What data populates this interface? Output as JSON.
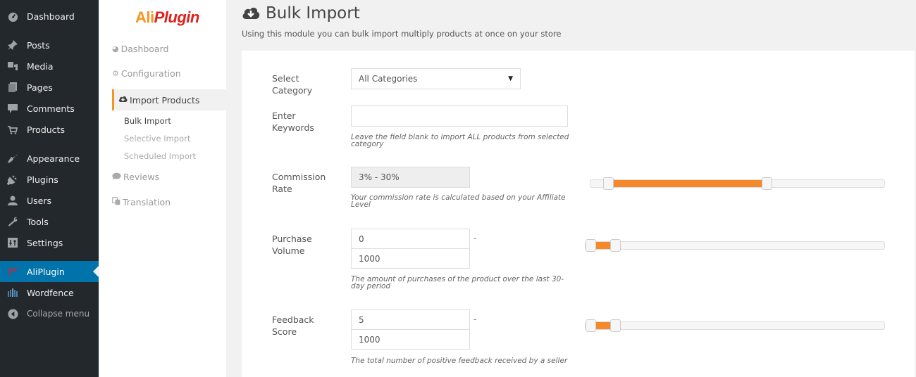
{
  "wp_sidebar": {
    "items": [
      {
        "label": "Dashboard",
        "icon": "dashboard-icon"
      },
      {
        "label": "Posts",
        "icon": "pin-icon"
      },
      {
        "label": "Media",
        "icon": "media-icon"
      },
      {
        "label": "Pages",
        "icon": "pages-icon"
      },
      {
        "label": "Comments",
        "icon": "comment-icon"
      },
      {
        "label": "Products",
        "icon": "cart-icon"
      },
      {
        "label": "Appearance",
        "icon": "brush-icon"
      },
      {
        "label": "Plugins",
        "icon": "plug-icon"
      },
      {
        "label": "Users",
        "icon": "user-icon"
      },
      {
        "label": "Tools",
        "icon": "wrench-icon"
      },
      {
        "label": "Settings",
        "icon": "settings-icon"
      },
      {
        "label": "AliPlugin",
        "icon": "aliplugin-icon",
        "active": true
      },
      {
        "label": "Wordfence",
        "icon": "wordfence-icon"
      },
      {
        "label": "Collapse menu",
        "icon": "collapse-icon"
      }
    ]
  },
  "plugin_nav": {
    "logo": {
      "part1": "Ali",
      "part2": "Plugin"
    },
    "items": [
      {
        "label": "Dashboard",
        "icon": "dashboard-icon"
      },
      {
        "label": "Configuration",
        "icon": "gear-icon"
      },
      {
        "label": "Import Products",
        "icon": "cloud-download-icon",
        "active": true
      },
      {
        "label": "Reviews",
        "icon": "comment-icon"
      },
      {
        "label": "Translation",
        "icon": "translate-icon"
      }
    ],
    "sub_items": [
      {
        "label": "Bulk Import",
        "current": true
      },
      {
        "label": "Selective Import"
      },
      {
        "label": "Scheduled Import"
      }
    ]
  },
  "header": {
    "title": "Bulk Import",
    "subtitle": "Using this module you can bulk import multiply products at once on your store"
  },
  "form": {
    "category": {
      "label": "Select Category",
      "value": "All Categories"
    },
    "keywords": {
      "label": "Enter Keywords",
      "value": "",
      "placeholder": "",
      "help": "Leave the field blank to import ALL products from selected category"
    },
    "commission": {
      "label": "Commission Rate",
      "value": "3% - 30%",
      "help": "Your commission rate is calculated based on your Affiliate Level",
      "slider": {
        "min_fraction": 0.06,
        "max_fraction": 0.6
      }
    },
    "purchase_volume": {
      "label": "Purchase Volume",
      "min": "0",
      "max": "1000",
      "separator": "-",
      "help": "The amount of purchases of the product over the last 30-day period",
      "slider": {
        "min_fraction": 0.0,
        "max_fraction": 0.1
      }
    },
    "feedback_score": {
      "label": "Feedback Score",
      "min": "5",
      "max": "1000",
      "separator": "-",
      "help": "The total number of positive feedback received by a seller",
      "slider": {
        "min_fraction": 0.0,
        "max_fraction": 0.1
      }
    }
  },
  "colors": {
    "accent": "#f5882b",
    "wp_active": "#0073aa",
    "wp_sidebar": "#23282d",
    "logo_orange": "#f7941d",
    "logo_red": "#e0201b"
  }
}
